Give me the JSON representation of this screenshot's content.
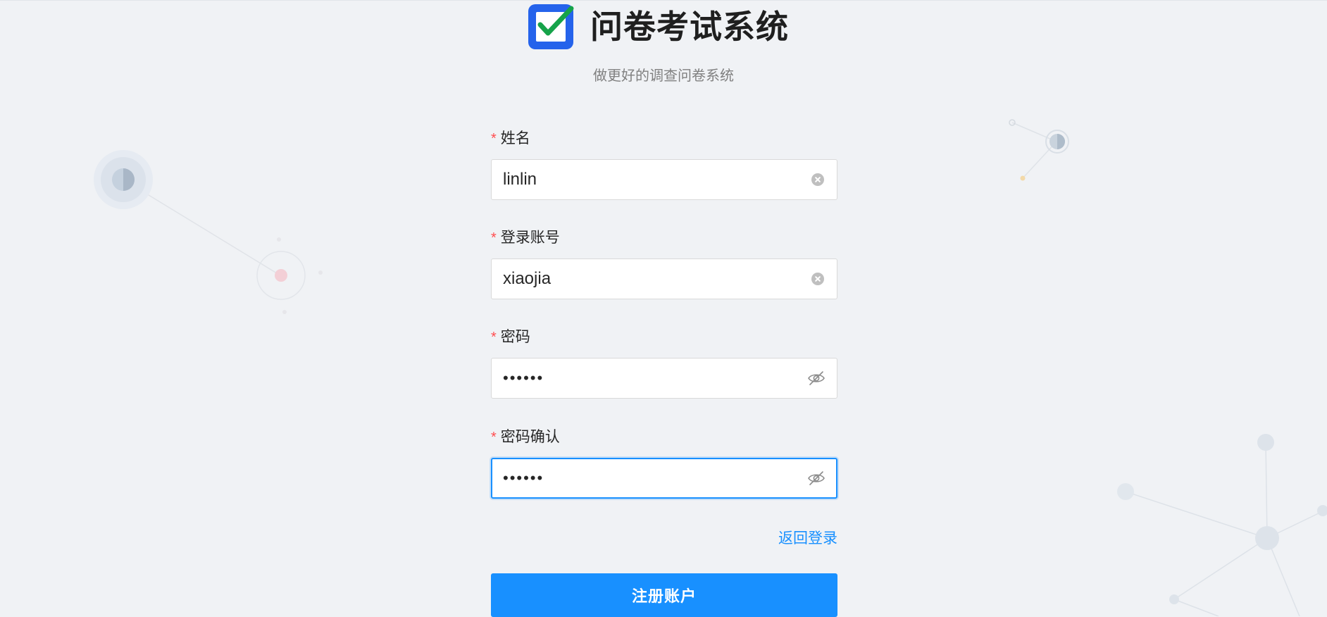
{
  "app": {
    "title": "问卷考试系统",
    "subtitle": "做更好的调查问卷系统"
  },
  "colors": {
    "primary": "#1890ff",
    "required": "#ff4d4f",
    "logo_blue": "#2563eb",
    "logo_check": "#16a34a",
    "background": "#f0f2f5"
  },
  "icons": {
    "logo": "checkbox-logo-icon",
    "clear": "clear-circle-icon",
    "password_visibility": "eye-invisible-icon"
  },
  "form": {
    "required_mark": "*",
    "name": {
      "label": "姓名",
      "value": "linlin"
    },
    "account": {
      "label": "登录账号",
      "value": "xiaojia"
    },
    "password": {
      "label": "密码",
      "value": "••••••"
    },
    "password_confirm": {
      "label": "密码确认",
      "value": "••••••"
    },
    "back_to_login": "返回登录",
    "submit_label": "注册账户"
  }
}
